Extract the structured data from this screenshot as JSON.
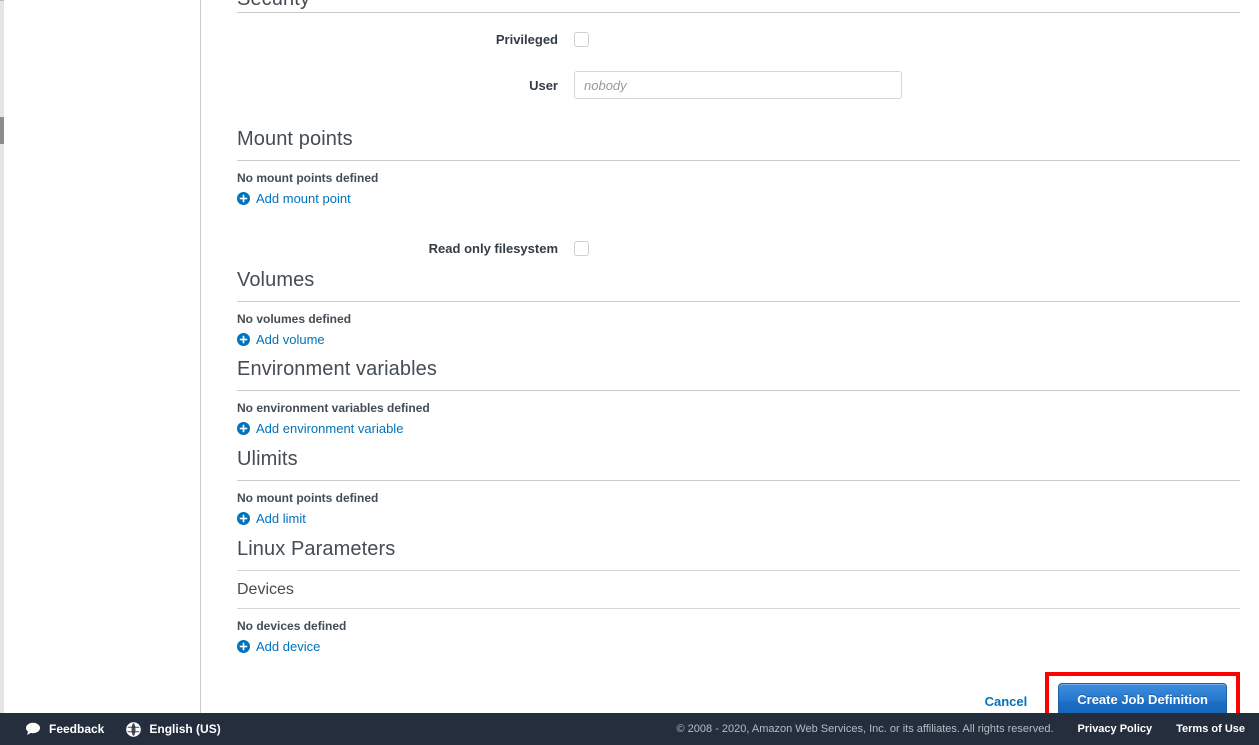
{
  "sections": {
    "security": {
      "title": "Security",
      "privileged_label": "Privileged",
      "user_label": "User",
      "user_placeholder": "nobody",
      "user_value": ""
    },
    "mount_points": {
      "title": "Mount points",
      "empty_text": "No mount points defined",
      "add_label": "Add mount point",
      "readonly_label": "Read only filesystem"
    },
    "volumes": {
      "title": "Volumes",
      "empty_text": "No volumes defined",
      "add_label": "Add volume"
    },
    "environment_variables": {
      "title": "Environment variables",
      "empty_text": "No environment variables defined",
      "add_label": "Add environment variable"
    },
    "ulimits": {
      "title": "Ulimits",
      "empty_text": "No mount points defined",
      "add_label": "Add limit"
    },
    "linux_parameters": {
      "title": "Linux Parameters",
      "devices": {
        "title": "Devices",
        "empty_text": "No devices defined",
        "add_label": "Add device"
      }
    }
  },
  "actions": {
    "cancel_label": "Cancel",
    "submit_label": "Create Job Definition",
    "highlight_color": "#ff0000",
    "submit_color": "#2477cc"
  },
  "footer": {
    "feedback_label": "Feedback",
    "language_label": "English (US)",
    "copyright": "© 2008 - 2020, Amazon Web Services, Inc. or its affiliates. All rights reserved.",
    "privacy_label": "Privacy Policy",
    "terms_label": "Terms of Use",
    "background": "#242e3d"
  },
  "icons": {
    "plus": "plus-circle-icon",
    "feedback": "speech-bubble-icon",
    "language": "globe-icon"
  }
}
